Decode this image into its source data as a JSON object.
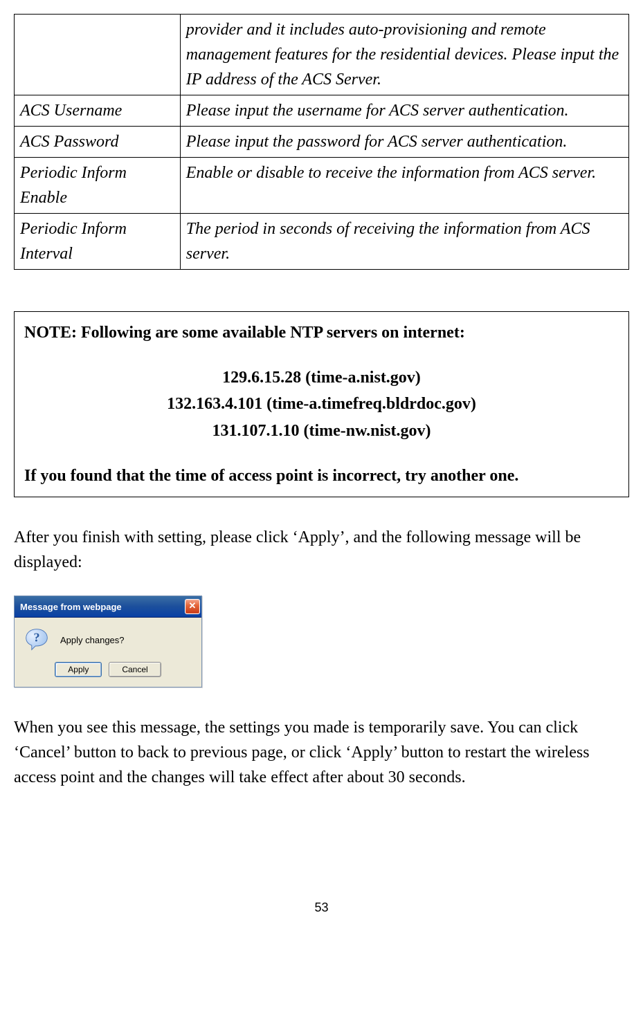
{
  "table": {
    "rows": [
      {
        "label": "",
        "desc": "provider and it includes auto-provisioning and remote management features for the residential devices. Please input the IP address of the ACS Server."
      },
      {
        "label": "ACS Username",
        "desc": "Please input the username for ACS server authentication."
      },
      {
        "label": "ACS Password",
        "desc": "Please input the password for ACS server authentication."
      },
      {
        "label": "Periodic Inform Enable",
        "desc": "Enable or disable to receive the information from ACS server."
      },
      {
        "label": "Periodic Inform Interval",
        "desc": "The period in seconds of receiving the information from ACS server."
      }
    ]
  },
  "note": {
    "heading": "NOTE: Following are some available NTP servers on internet:",
    "server1": "129.6.15.28 (time-a.nist.gov)",
    "server2": "132.163.4.101 (time-a.timefreq.bldrdoc.gov)",
    "server3": "131.107.1.10 (time-nw.nist.gov)",
    "footer": "If you found that the time of access point is incorrect, try another one."
  },
  "para1": "After you finish with setting, please click ‘Apply’, and the following message will be displayed:",
  "dialog": {
    "title": "Message from webpage",
    "text": "Apply changes?",
    "apply": "Apply",
    "cancel": "Cancel"
  },
  "para2": "When you see this message, the settings you made is temporarily save. You can click ‘Cancel’ button to back to previous page, or click ‘Apply’ button to restart the wireless access point and the changes will take effect after about 30 seconds.",
  "page_number": "53"
}
